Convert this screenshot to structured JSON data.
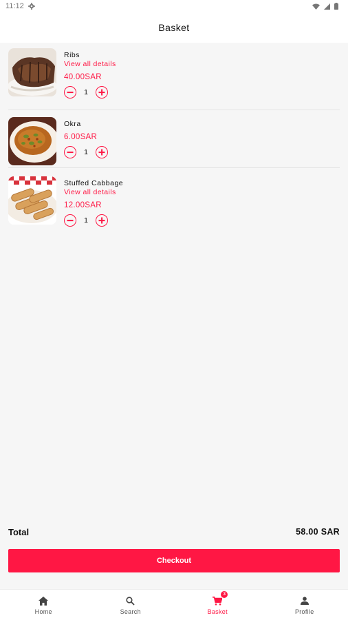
{
  "status": {
    "time": "11:12"
  },
  "header": {
    "title": "Basket"
  },
  "basket": {
    "items": [
      {
        "name": "Ribs",
        "details": "View all details",
        "price": "40.00SAR",
        "qty": "1",
        "image": "ribs-food-image"
      },
      {
        "name": "Okra",
        "details": "",
        "price": "6.00SAR",
        "qty": "1",
        "image": "okra-food-image"
      },
      {
        "name": "Stuffed Cabbage",
        "details": "View all details",
        "price": "12.00SAR",
        "qty": "1",
        "image": "stuffed-cabbage-food-image"
      }
    ]
  },
  "summary": {
    "total_label": "Total",
    "total_value": "58.00 SAR"
  },
  "checkout": {
    "label": "Checkout"
  },
  "nav": {
    "items": [
      {
        "label": "Home",
        "icon": "home-icon"
      },
      {
        "label": "Search",
        "icon": "search-icon"
      },
      {
        "label": "Basket",
        "icon": "cart-icon",
        "badge": "3",
        "active": true
      },
      {
        "label": "Profile",
        "icon": "person-icon"
      }
    ]
  },
  "colors": {
    "accent": "#ff1744",
    "background": "#f6f6f6",
    "surface": "#ffffff"
  }
}
